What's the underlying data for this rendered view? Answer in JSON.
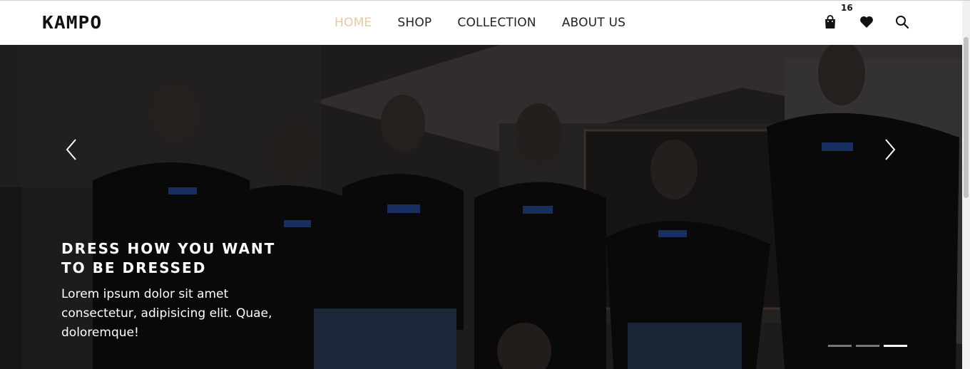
{
  "brand": {
    "logo_text": "KAMPO"
  },
  "nav": {
    "items": [
      {
        "label": "HOME",
        "active": true
      },
      {
        "label": "SHOP",
        "active": false
      },
      {
        "label": "COLLECTION",
        "active": false
      },
      {
        "label": "ABOUT US",
        "active": false
      }
    ]
  },
  "actions": {
    "cart_icon": "shopping-bag-icon",
    "cart_count": "16",
    "wishlist_icon": "heart-icon",
    "search_icon": "search-icon"
  },
  "hero": {
    "heading": "DRESS HOW YOU WANT TO BE DRESSED",
    "body": "Lorem ipsum dolor sit amet consectetur, adipisicing elit. Quae, doloremque!",
    "prev_icon": "chevron-left-icon",
    "next_icon": "chevron-right-icon",
    "slide_count": 3,
    "active_slide": 3
  },
  "colors": {
    "active_nav": "#e9c9a0",
    "text_dark": "#222222",
    "hero_text": "#ffffff"
  }
}
